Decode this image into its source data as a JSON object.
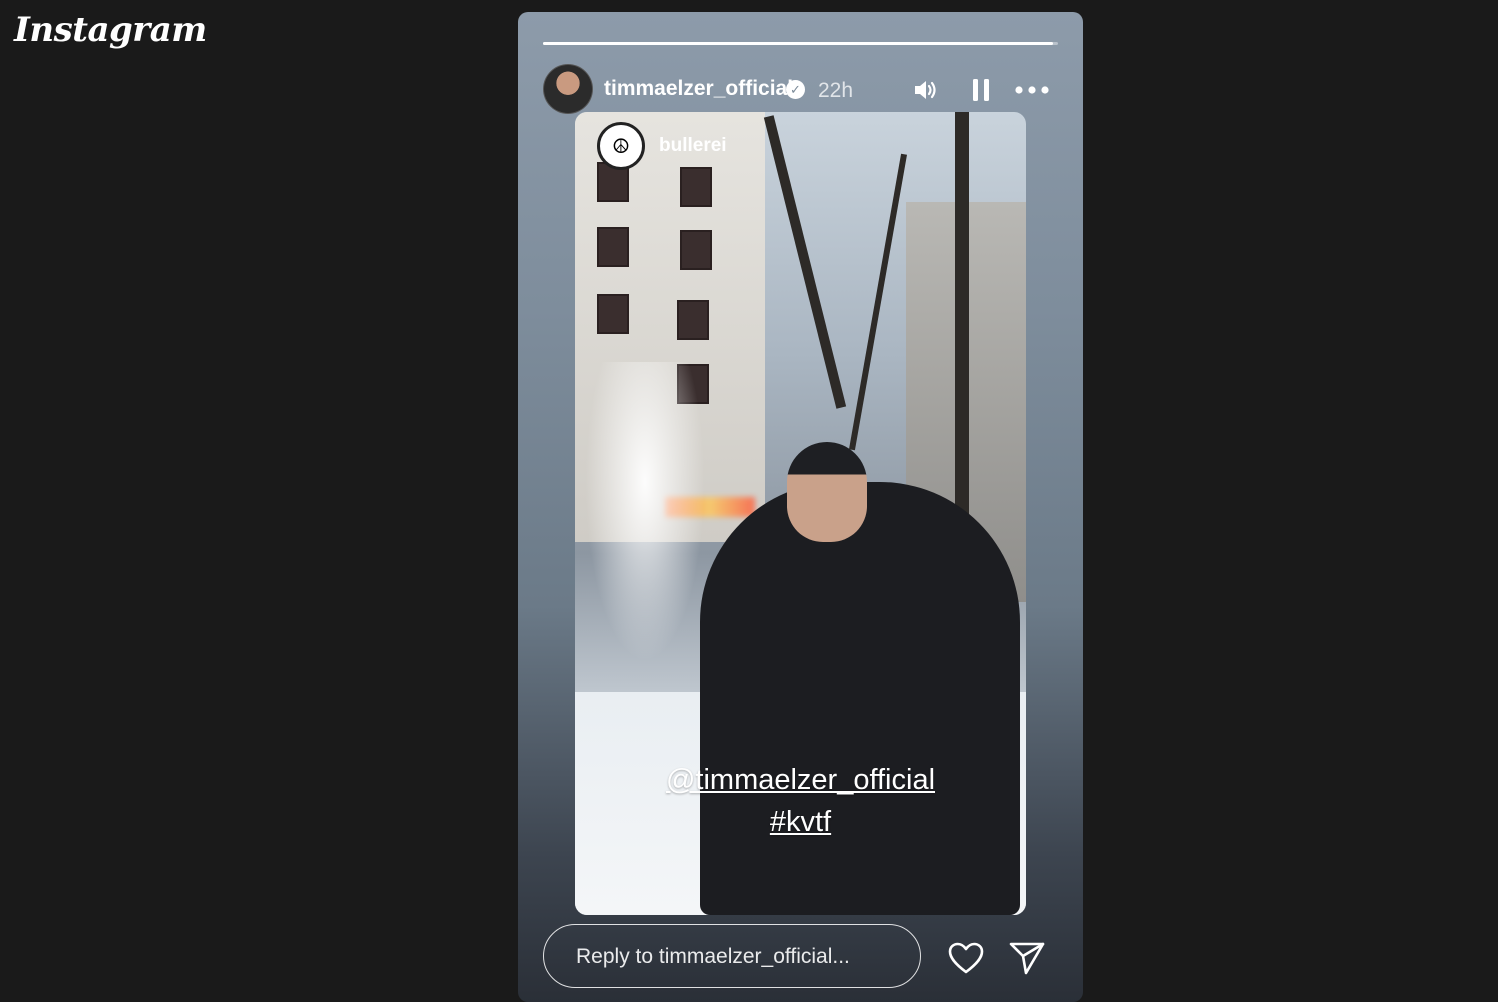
{
  "app": {
    "logo_text": "Instagram"
  },
  "story": {
    "progress_fraction": 0.99,
    "author": {
      "username": "timmaelzer_official",
      "verified": true,
      "time_ago": "22h"
    },
    "controls": {
      "sound_icon": "volume-icon",
      "pause_icon": "pause-icon",
      "more_icon": "more-options-icon"
    },
    "reshared_from": {
      "username": "bullerei",
      "avatar_symbol": "☮"
    },
    "stickers": {
      "mention": "@timmaelzer_official",
      "hashtag": "#kvtf"
    }
  },
  "reply": {
    "placeholder": "Reply to timmaelzer_official...",
    "like_icon": "heart-icon",
    "share_icon": "send-icon"
  }
}
